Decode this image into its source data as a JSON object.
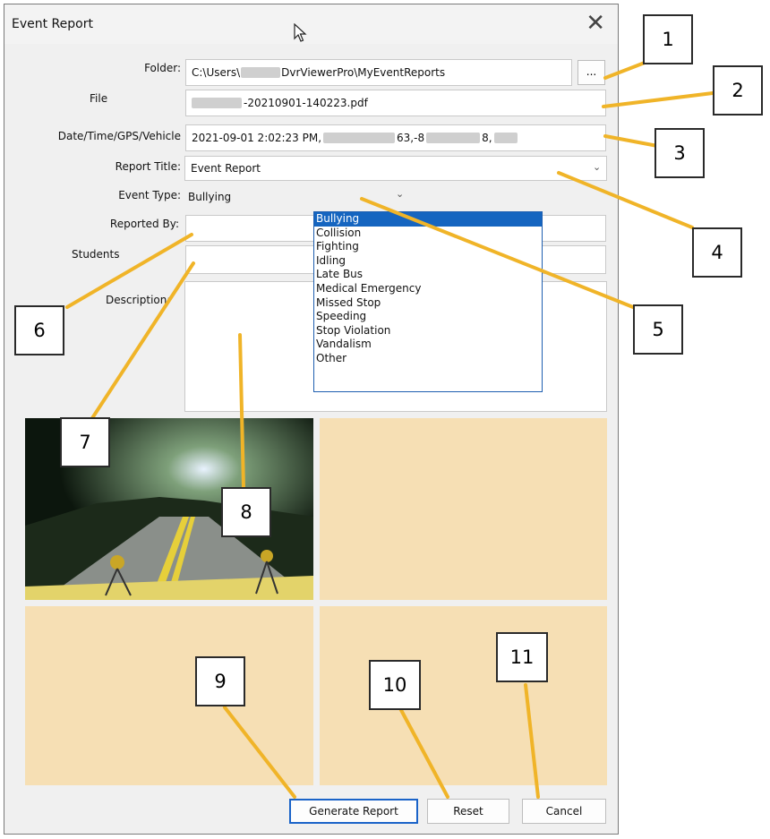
{
  "window": {
    "title": "Event Report",
    "close_glyph": "✕"
  },
  "form": {
    "folder_label": "Folder:",
    "folder_prefix": "C:\\Users\\",
    "folder_suffix": "DvrViewerPro\\MyEventReports",
    "browse_label": "...",
    "file_label": "File",
    "file_value": "-20210901-140223.pdf",
    "datetime_label": "Date/Time/GPS/Vehicle",
    "datetime_value": "2021-09-01 2:02:23 PM,",
    "datetime_mid": "63,-8",
    "datetime_end": "8,",
    "report_title_label": "Report Title:",
    "report_title_value": "Event Report",
    "event_type_label": "Event Type:",
    "event_type_value": "Bullying",
    "reported_by_label": "Reported By:",
    "students_label": "Students",
    "description_label": "Description:"
  },
  "event_type_options": [
    "Bullying",
    "Collision",
    "Fighting",
    "Idling",
    "Late Bus",
    "Medical Emergency",
    "Missed Stop",
    "Speeding",
    "Stop Violation",
    "Vandalism",
    "Other"
  ],
  "buttons": {
    "generate": "Generate Report",
    "reset": "Reset",
    "cancel": "Cancel"
  },
  "callouts": [
    "1",
    "2",
    "3",
    "4",
    "5",
    "6",
    "7",
    "8",
    "9",
    "10",
    "11"
  ],
  "colors": {
    "accent": "#1565c0",
    "panel": "#f6dfb4",
    "callout_line": "#f0b428"
  },
  "icons": {
    "cursor": "mouse-pointer-icon",
    "close": "close-icon",
    "dropdown": "chevron-down-icon"
  }
}
